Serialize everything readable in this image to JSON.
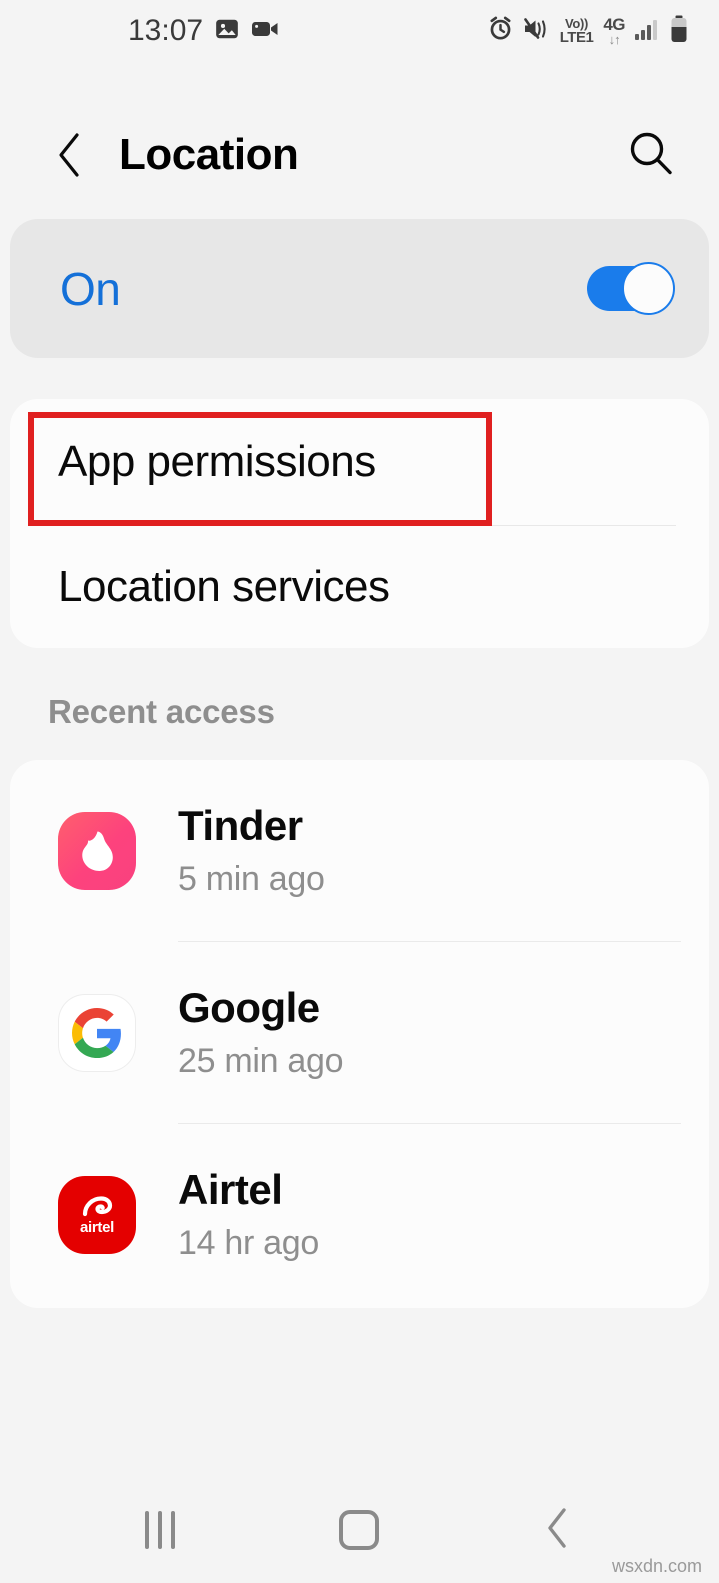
{
  "status_bar": {
    "time": "13:07",
    "left_icons": [
      "image-icon",
      "video-camera-icon"
    ],
    "right_icons": [
      "alarm-icon",
      "mute-vibrate-icon",
      "volte-icon",
      "network-4g-icon",
      "signal-bars-icon",
      "battery-icon"
    ],
    "volte_top": "Vo))",
    "volte_bottom": "LTE1",
    "network_type": "4G",
    "data_arrows": "↓↑"
  },
  "header": {
    "back_icon": "chevron-left-icon",
    "title": "Location",
    "search_icon": "search-icon"
  },
  "master_toggle": {
    "label": "On",
    "enabled": true,
    "accent_color": "#1a7ceb",
    "label_color": "#1470d8",
    "card_bg": "#e7e7e7"
  },
  "settings": {
    "rows": [
      {
        "label": "App permissions",
        "highlighted": true
      },
      {
        "label": "Location services",
        "highlighted": false
      }
    ],
    "highlight_color": "#e02020"
  },
  "recent_access": {
    "section_title": "Recent access",
    "apps": [
      {
        "name": "Tinder",
        "time": "5 min ago",
        "icon": "tinder-icon"
      },
      {
        "name": "Google",
        "time": "25 min ago",
        "icon": "google-icon"
      },
      {
        "name": "Airtel",
        "time": "14 hr ago",
        "icon": "airtel-icon"
      }
    ]
  },
  "nav_bar": {
    "recents_icon": "recents-icon",
    "home_icon": "home-icon",
    "back_icon": "back-icon"
  },
  "watermark": "wsxdn.com"
}
